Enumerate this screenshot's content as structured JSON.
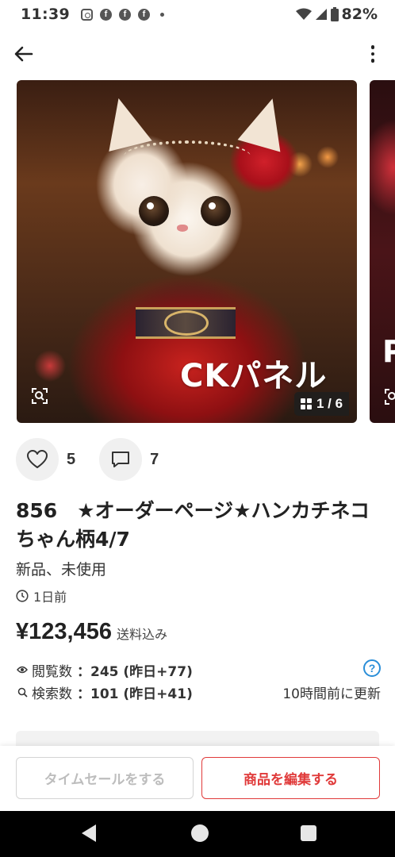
{
  "status": {
    "time": "11:39",
    "battery": "82%"
  },
  "listing": {
    "image_watermark": "CKパネル",
    "image_counter": "1 / 6",
    "likes": "5",
    "comments": "7",
    "title": "856　★オーダーページ★ハンカチネコちゃん柄4/7",
    "condition": "新品、未使用",
    "posted": "1日前",
    "price": "¥123,456",
    "shipping": "送料込み",
    "views_label": "閲覧数",
    "views_value": "：245 (昨日+77)",
    "searches_label": "検索数",
    "searches_value": "：101 (昨日+41)",
    "updated": "10時間前に更新"
  },
  "buttons": {
    "time_sale": "タイムセールをする",
    "edit": "商品を編集する"
  },
  "colors": {
    "accent": "#e03a3a",
    "help": "#2a8ed8",
    "disabled": "#bdbdbd"
  },
  "icons": [
    "back-arrow-icon",
    "more-vert-icon",
    "heart-icon",
    "comment-icon",
    "clock-icon",
    "eye-icon",
    "search-icon",
    "help-icon",
    "zoom-icon",
    "grid-icon"
  ]
}
